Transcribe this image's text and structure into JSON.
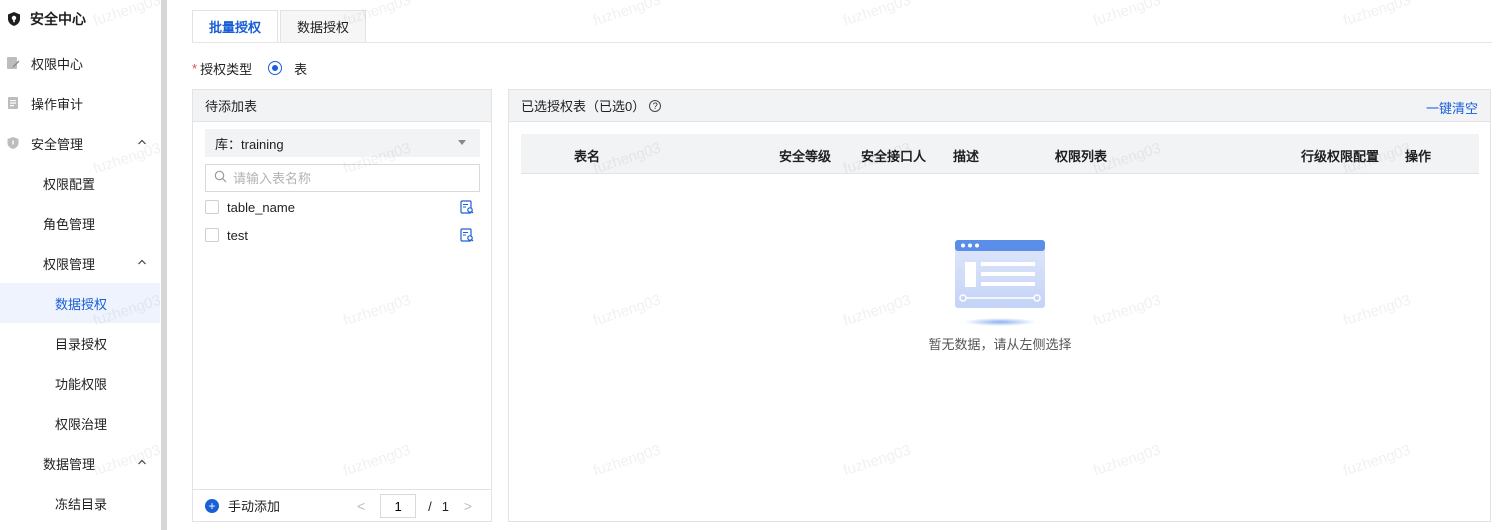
{
  "sidebar": {
    "brand": "安全中心",
    "items": [
      {
        "label": "权限中心"
      },
      {
        "label": "操作审计"
      },
      {
        "label": "安全管理"
      },
      {
        "label": "权限配置"
      },
      {
        "label": "角色管理"
      },
      {
        "label": "权限管理"
      },
      {
        "label": "数据授权"
      },
      {
        "label": "目录授权"
      },
      {
        "label": "功能权限"
      },
      {
        "label": "权限治理"
      },
      {
        "label": "数据管理"
      },
      {
        "label": "冻结目录"
      }
    ]
  },
  "tabs": [
    {
      "label": "批量授权",
      "active": true
    },
    {
      "label": "数据授权",
      "active": false
    }
  ],
  "auth": {
    "required_mark": "*",
    "label": "授权类型",
    "option": "表"
  },
  "left_panel": {
    "title": "待添加表",
    "db_select": "库：training",
    "search_placeholder": "请输入表名称",
    "tables": [
      {
        "name": "table_name"
      },
      {
        "name": "test"
      }
    ],
    "add_manual": "手动添加",
    "pager": {
      "current": "1",
      "slash": "/",
      "total": "1",
      "prev": "<",
      "next": ">"
    }
  },
  "right_panel": {
    "title": "已选授权表（已选0）",
    "help_glyph": "?",
    "clear_all": "一键清空",
    "columns": [
      "表名",
      "安全等级",
      "安全接口人",
      "描述",
      "权限列表",
      "行级权限配置",
      "操作"
    ],
    "empty_text": "暂无数据，请从左侧选择"
  },
  "watermark": "fuzheng03",
  "colors": {
    "accent": "#1a5fd6",
    "active_bg": "#eef3fd",
    "header_bg": "#f2f3f5"
  }
}
